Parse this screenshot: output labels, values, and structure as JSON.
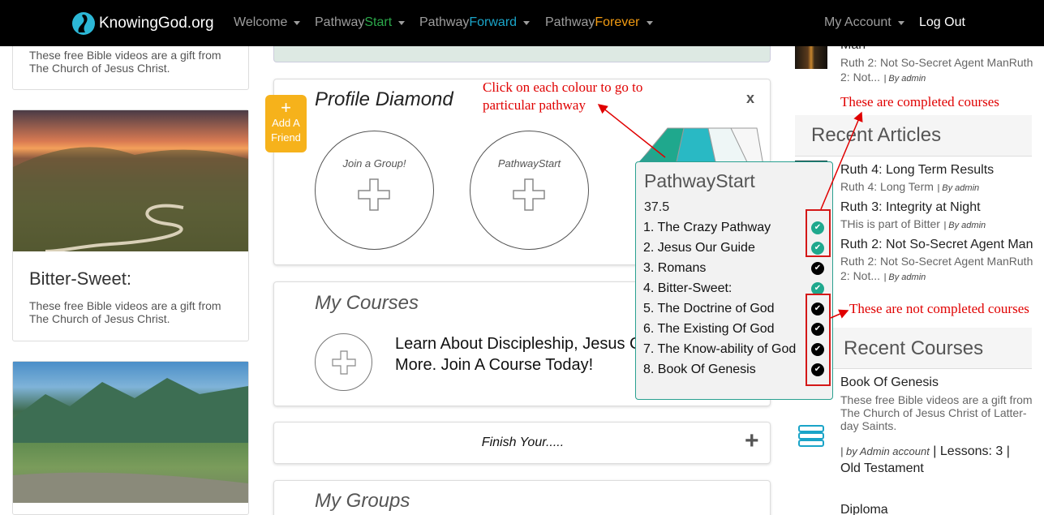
{
  "nav": {
    "brand": "KnowingGod.org",
    "items": [
      {
        "prefix": "",
        "label": "Welcome",
        "suffix": ""
      },
      {
        "prefix": "Pathway",
        "label": "",
        "suffix": "Start"
      },
      {
        "prefix": "Pathway",
        "label": "",
        "suffix": "Forward"
      },
      {
        "prefix": "Pathway",
        "label": "",
        "suffix": "Forever"
      }
    ],
    "my_account": "My Account",
    "logout": "Log Out"
  },
  "left": {
    "card1_text": "These free Bible videos are a gift from The Church of Jesus Christ.",
    "card2_title": "Bitter-Sweet:",
    "card2_text": "These free Bible videos are a gift from The Church of Jesus Christ."
  },
  "profile": {
    "title": "Profile Diamond",
    "close": "x",
    "add_friend_plus": "+",
    "add_friend": "Add A Friend",
    "join_group": "Join a Group!",
    "pathway_start": "PathwayStart"
  },
  "courses": {
    "title": "My Courses",
    "text": "Learn About Discipleship, Jesus Christ and Much More. Join A Course Today!"
  },
  "finish": {
    "label": "Finish Your.....",
    "plus": "+"
  },
  "groups": {
    "title": "My Groups"
  },
  "popup": {
    "title": "PathwayStart",
    "score": "37.5",
    "items": [
      {
        "label": "1. The Crazy Pathway",
        "done": true
      },
      {
        "label": "2. Jesus Our Guide",
        "done": true
      },
      {
        "label": "3. Romans",
        "done": false
      },
      {
        "label": "4. Bitter-Sweet:",
        "done": true
      },
      {
        "label": "5. The Doctrine of God",
        "done": false
      },
      {
        "label": "6. The Existing Of God",
        "done": false
      },
      {
        "label": "7. The Know-ability of God",
        "done": false
      },
      {
        "label": "8. Book Of Genesis",
        "done": false
      }
    ]
  },
  "sidebar": {
    "top_title_fragment": "Man",
    "top_sub": "Ruth 2: Not So-Secret Agent ManRuth 2: Not...",
    "top_by": "| By admin",
    "recent_articles": "Recent Articles",
    "articles": [
      {
        "title": "Ruth 4: Long Term Results",
        "sub": "Ruth 4: Long Term",
        "by": "| By admin"
      },
      {
        "title": "Ruth 3: Integrity at Night",
        "sub": "THis is part of Bitter",
        "by": "| By admin"
      },
      {
        "title": "Ruth 2: Not So-Secret Agent Man",
        "sub": "Ruth 2: Not So-Secret Agent ManRuth 2: Not...",
        "by": "| By admin"
      }
    ],
    "recent_courses": "Recent Courses",
    "course_title": "Book Of Genesis",
    "course_desc": "These free Bible videos are a gift from The Church of Jesus Christ of Latter-day Saints.",
    "course_by": "| by Admin account",
    "course_lessons": "| Lessons: 3 |",
    "course_cat": "Old Testament",
    "next_title": "Diploma"
  },
  "annotations": {
    "click": "Click on each colour to go to particular pathway",
    "completed": "These are completed courses",
    "not_completed": "These are not completed courses"
  },
  "colors": {
    "nav_bg": "#000000",
    "start": "#2ba84a",
    "forward": "#1aa4c8",
    "forever": "#f29b12",
    "add_friend": "#f6b21b",
    "check_done": "#1fa88d",
    "annotation": "#e00000"
  }
}
